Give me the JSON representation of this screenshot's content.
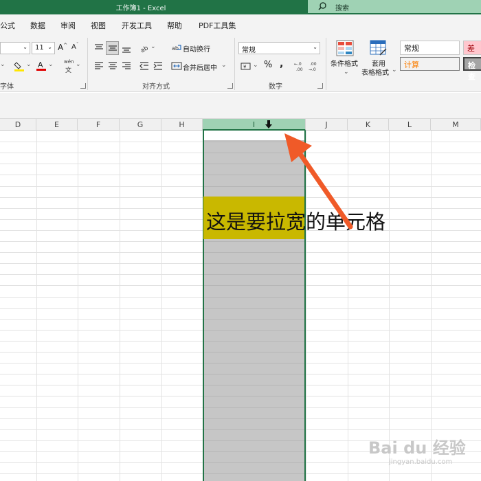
{
  "title": "工作簿1  -  Excel",
  "search": {
    "label": "搜索"
  },
  "menu": [
    "公式",
    "数据",
    "审阅",
    "视图",
    "开发工具",
    "帮助",
    "PDF工具集"
  ],
  "ribbon": {
    "font_size": "11",
    "font_grow": "A",
    "font_shrink": "A",
    "wrap_text": "自动换行",
    "merge_center": "合并后居中",
    "number_format": "常规",
    "percent": "%",
    "comma": ",",
    "phonetic_top": "wén",
    "phonetic_bottom": "文",
    "conditional_format": "条件格式",
    "table_format_1": "套用",
    "table_format_2": "表格格式",
    "style_normal": "常规",
    "style_bad": "差",
    "style_calc": "计算",
    "style_check": "检查",
    "groups": {
      "font": "字体",
      "alignment": "对齐方式",
      "number": "数字"
    }
  },
  "columns": [
    "D",
    "E",
    "F",
    "G",
    "H",
    "I",
    "J",
    "K",
    "L",
    "M"
  ],
  "selected_column": "I",
  "annotation": "这是要拉宽的单元格",
  "watermark": {
    "brand": "Bai du 经验",
    "url": "jingyan.baidu.com"
  },
  "colors": {
    "excel_green": "#217346",
    "selection_gray": "#c6c6c6",
    "highlight": "#c9b800",
    "arrow": "#f05a28"
  }
}
